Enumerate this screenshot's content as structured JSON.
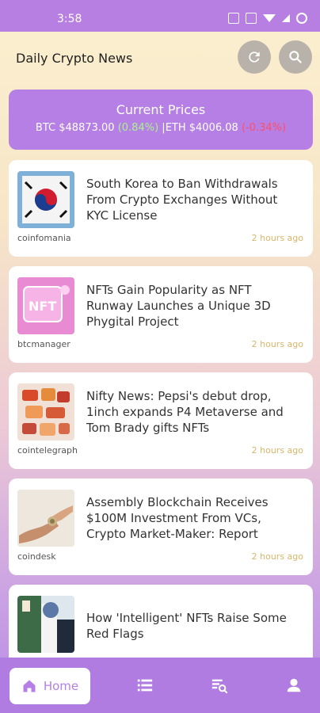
{
  "status": {
    "time": "3:58",
    "icons": [
      "data-icon",
      "sim-icon",
      "wifi-icon",
      "signal-icon",
      "battery-ring-icon"
    ]
  },
  "header": {
    "title": "Daily Crypto News",
    "refresh_icon": "refresh-icon",
    "search_icon": "search-icon"
  },
  "prices": {
    "label": "Current Prices",
    "btc_label": "BTC",
    "btc_value": "$48873.00",
    "btc_change": "(0.84%)",
    "separator": "|",
    "eth_label": "ETH",
    "eth_value": "$4006.08",
    "eth_change": "(-0.34%)",
    "positive_color": "#a9f28d",
    "negative_color": "#ff4f66"
  },
  "news": [
    {
      "headline": "South Korea to Ban Withdrawals From Crypto Exchanges Without KYC License",
      "source": "coinfomania",
      "time": "2 hours ago"
    },
    {
      "headline": "NFTs Gain Popularity as NFT Runway Launches a Unique 3D Phygital Project",
      "source": "btcmanager",
      "time": "2 hours ago",
      "thumb_text": "NFT"
    },
    {
      "headline": "Nifty News: Pepsi's debut drop, 1inch expands P4 Metaverse and Tom Brady gifts NFTs",
      "source": "cointelegraph",
      "time": "2 hours ago"
    },
    {
      "headline": "Assembly Blockchain Receives $100M Investment From VCs, Crypto Market-Maker: Report",
      "source": "coindesk",
      "time": "2 hours ago"
    },
    {
      "headline": "How 'Intelligent' NFTs Raise Some Red Flags",
      "source": "",
      "time": ""
    }
  ],
  "nav": {
    "home_label": "Home",
    "home_icon": "home-icon",
    "list_icon": "list-icon",
    "search_icon": "search-list-icon",
    "profile_icon": "person-icon"
  }
}
